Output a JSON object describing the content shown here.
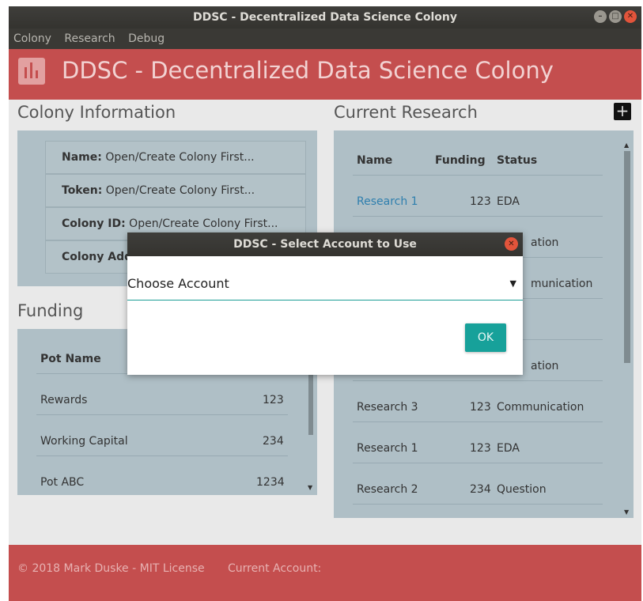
{
  "window": {
    "title": "DDSC - Decentralized Data Science Colony"
  },
  "menu": [
    "Colony",
    "Research",
    "Debug"
  ],
  "header": {
    "title": "DDSC - Decentralized Data Science Colony"
  },
  "colony_info": {
    "heading": "Colony Information",
    "rows": [
      {
        "label": "Name:",
        "value": "Open/Create Colony First..."
      },
      {
        "label": "Token:",
        "value": "Open/Create Colony First..."
      },
      {
        "label": "Colony ID:",
        "value": "Open/Create Colony First..."
      },
      {
        "label": "Colony Address:",
        "value": ""
      }
    ]
  },
  "funding": {
    "heading": "Funding",
    "column": "Pot Name",
    "rows": [
      {
        "name": "Rewards",
        "amount": "123"
      },
      {
        "name": "Working Capital",
        "amount": "234"
      },
      {
        "name": "Pot ABC",
        "amount": "1234"
      }
    ]
  },
  "research": {
    "heading": "Current Research",
    "add_icon": "plus-icon",
    "columns": {
      "name": "Name",
      "funding": "Funding",
      "status": "Status"
    },
    "rows": [
      {
        "name": "Research 1",
        "funding": "123",
        "status": "EDA"
      },
      {
        "name": "",
        "funding": "",
        "status": "ation"
      },
      {
        "name": "",
        "funding": "",
        "status": "munication"
      },
      {
        "name": "",
        "funding": "",
        "status": ""
      },
      {
        "name": "",
        "funding": "",
        "status": "ation"
      },
      {
        "name": "Research 3",
        "funding": "123",
        "status": "Communication"
      },
      {
        "name": "Research 1",
        "funding": "123",
        "status": "EDA"
      },
      {
        "name": "Research 2",
        "funding": "234",
        "status": "Question"
      }
    ]
  },
  "footer": {
    "copyright": "© 2018 Mark Duske - MIT License",
    "account_label": "Current Account:"
  },
  "dialog": {
    "title": "DDSC - Select Account to Use",
    "select_value": "Choose Account",
    "ok_label": "OK"
  },
  "colors": {
    "header": "#c44e4e",
    "card": "#afbfc6",
    "accent": "#17a19a",
    "link": "#2f7fae"
  }
}
